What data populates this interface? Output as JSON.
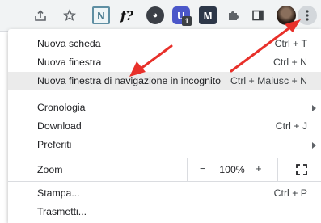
{
  "toolbar": {
    "icons": [
      "share-icon",
      "star-icon",
      "notion-extension-icon",
      "formula-extension-icon",
      "ghost-extension-icon",
      "u-extension-icon",
      "m-extension-icon",
      "extensions-puzzle-icon",
      "side-panel-icon",
      "profile-avatar",
      "menu-dots-icon"
    ],
    "ext_n_glyph": "N",
    "ext_f_glyph": "f?",
    "ext_ghost_glyph": "◕",
    "ext_u_glyph": "U",
    "ext_u_badge": "1",
    "ext_m_glyph": "M"
  },
  "menu": {
    "items_group1": [
      {
        "label": "Nuova scheda",
        "shortcut": "Ctrl + T"
      },
      {
        "label": "Nuova finestra",
        "shortcut": "Ctrl + N"
      },
      {
        "label": "Nuova finestra di navigazione in incognito",
        "shortcut": "Ctrl + Maiusc + N"
      }
    ],
    "items_group2": [
      {
        "label": "Cronologia",
        "shortcut": ""
      },
      {
        "label": "Download",
        "shortcut": "Ctrl + J"
      },
      {
        "label": "Preferiti",
        "shortcut": ""
      }
    ],
    "zoom": {
      "label": "Zoom",
      "minus": "−",
      "value": "100%",
      "plus": "+"
    },
    "items_group3": [
      {
        "label": "Stampa...",
        "shortcut": "Ctrl + P"
      },
      {
        "label": "Trasmetti...",
        "shortcut": ""
      }
    ]
  },
  "colors": {
    "annotation_arrow": "#e8302a",
    "highlight_row": "#ebebeb"
  }
}
